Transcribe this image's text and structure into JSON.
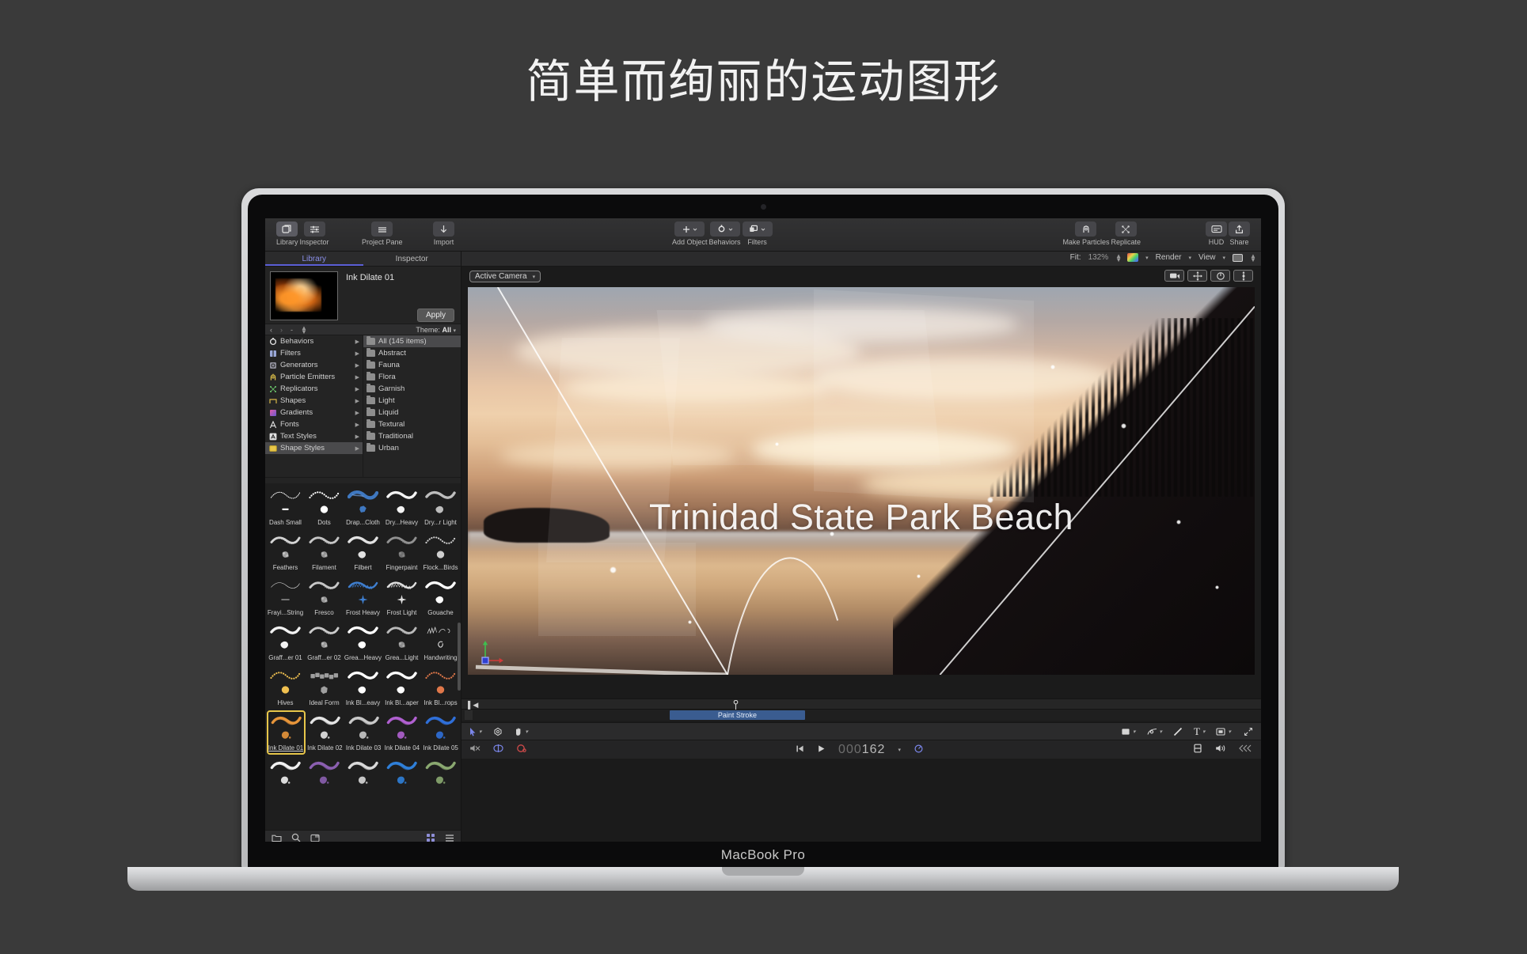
{
  "headline": "简单而绚丽的运动图形",
  "device": {
    "name": "MacBook Pro"
  },
  "toolbar": {
    "left_buttons": [
      {
        "label": "Library",
        "icon": "library-icon",
        "selected": true
      },
      {
        "label": "Inspector",
        "icon": "inspector-sliders-icon",
        "selected": false
      }
    ],
    "project_pane": {
      "label": "Project Pane",
      "icon": "list-lines-icon"
    },
    "import": {
      "label": "Import",
      "icon": "download-arrow-icon"
    },
    "center_buttons": [
      {
        "label": "Add Object",
        "icon": "plus-icon"
      },
      {
        "label": "Behaviors",
        "icon": "gear-circle-icon"
      },
      {
        "label": "Filters",
        "icon": "stacked-squares-icon"
      }
    ],
    "right_buttons": [
      {
        "label": "Make Particles",
        "icon": "particles-icon"
      },
      {
        "label": "Replicate",
        "icon": "replicate-icon"
      },
      {
        "label": "HUD",
        "icon": "hud-panel-icon"
      },
      {
        "label": "Share",
        "icon": "share-upload-icon"
      }
    ]
  },
  "infostrip": {
    "fit_label": "Fit:",
    "fit_value": "132%",
    "color_swatch_icon": "color-gradient-icon",
    "render_label": "Render",
    "view_label": "View",
    "display_icon": "display-rect-icon"
  },
  "left_panel": {
    "tabs": [
      {
        "label": "Library",
        "active": true
      },
      {
        "label": "Inspector",
        "active": false
      }
    ],
    "preview": {
      "name": "Ink Dilate 01",
      "apply_label": "Apply",
      "thumbnail_icon": "ink-dilate-thumbnail"
    },
    "libnav": {
      "back_icon": "chevron-left-icon",
      "forward_icon": "chevron-right-icon",
      "path": "-",
      "sort_icon": "sort-updown-icon",
      "theme_label": "Theme:",
      "theme_value": "All"
    },
    "categories": [
      {
        "label": "Behaviors",
        "icon": "behaviors-icon",
        "selected": false
      },
      {
        "label": "Filters",
        "icon": "filters-icon",
        "selected": false
      },
      {
        "label": "Generators",
        "icon": "generators-icon",
        "selected": false
      },
      {
        "label": "Particle Emitters",
        "icon": "particle-emitters-icon",
        "selected": false
      },
      {
        "label": "Replicators",
        "icon": "replicators-icon",
        "selected": false
      },
      {
        "label": "Shapes",
        "icon": "shapes-icon",
        "selected": false
      },
      {
        "label": "Gradients",
        "icon": "gradients-icon",
        "selected": false
      },
      {
        "label": "Fonts",
        "icon": "fonts-icon",
        "selected": false
      },
      {
        "label": "Text Styles",
        "icon": "text-styles-icon",
        "selected": false
      },
      {
        "label": "Shape Styles",
        "icon": "shape-styles-icon",
        "selected": true
      }
    ],
    "themes": [
      {
        "label": "All (145 items)",
        "selected": true
      },
      {
        "label": "Abstract",
        "selected": false
      },
      {
        "label": "Fauna",
        "selected": false
      },
      {
        "label": "Flora",
        "selected": false
      },
      {
        "label": "Garnish",
        "selected": false
      },
      {
        "label": "Light",
        "selected": false
      },
      {
        "label": "Liquid",
        "selected": false
      },
      {
        "label": "Textural",
        "selected": false
      },
      {
        "label": "Traditional",
        "selected": false
      },
      {
        "label": "Urban",
        "selected": false
      }
    ],
    "brushes": [
      {
        "label": "Dash Small",
        "color": "#ffffff",
        "style": "dash",
        "selected": false
      },
      {
        "label": "Dots",
        "color": "#ffffff",
        "style": "dots",
        "selected": false
      },
      {
        "label": "Drap...Cloth",
        "color": "#3f78c0",
        "style": "cloth",
        "selected": false
      },
      {
        "label": "Dry...Heavy",
        "color": "#f4f4f4",
        "style": "solid",
        "selected": false
      },
      {
        "label": "Dry...r Light",
        "color": "#bdbdbd",
        "style": "solid",
        "selected": false
      },
      {
        "label": "Feathers",
        "color": "#e6e6e6",
        "style": "rough",
        "selected": false
      },
      {
        "label": "Filament",
        "color": "#d6d6d6",
        "style": "rough",
        "selected": false
      },
      {
        "label": "Filbert",
        "color": "#e2e2e2",
        "style": "solid",
        "selected": false
      },
      {
        "label": "Fingerpaint",
        "color": "#9c9c9c",
        "style": "rough",
        "selected": false
      },
      {
        "label": "Flock...Birds",
        "color": "#cfcfcf",
        "style": "dots",
        "selected": false
      },
      {
        "label": "Frayi...String",
        "color": "#e8e8e8",
        "style": "thin",
        "selected": false
      },
      {
        "label": "Fresco",
        "color": "#d8d8d8",
        "style": "rough",
        "selected": false
      },
      {
        "label": "Frost Heavy",
        "color": "#3f7fd0",
        "style": "spiky",
        "selected": false
      },
      {
        "label": "Frost Light",
        "color": "#e0e0e0",
        "style": "spiky",
        "selected": false
      },
      {
        "label": "Gouache",
        "color": "#ffffff",
        "style": "solid",
        "selected": false
      },
      {
        "label": "Graff...er 01",
        "color": "#f2f2f2",
        "style": "solid",
        "selected": false
      },
      {
        "label": "Graff...er 02",
        "color": "#dcdcdc",
        "style": "rough",
        "selected": false
      },
      {
        "label": "Grea...Heavy",
        "color": "#ffffff",
        "style": "solid",
        "selected": false
      },
      {
        "label": "Grea...Light",
        "color": "#c9c9c9",
        "style": "rough",
        "selected": false
      },
      {
        "label": "Handwriting",
        "color": "#e9e9e9",
        "style": "script",
        "selected": false
      },
      {
        "label": "Hives",
        "color": "#f0c050",
        "style": "dots",
        "selected": false
      },
      {
        "label": "Ideal Form",
        "color": "#b6b6b6",
        "style": "blocks",
        "selected": false
      },
      {
        "label": "Ink Bl...eavy",
        "color": "#ffffff",
        "style": "solid",
        "selected": false
      },
      {
        "label": "Ink Bl...aper",
        "color": "#ffffff",
        "style": "solid",
        "selected": false
      },
      {
        "label": "Ink Bl...rops",
        "color": "#e0784a",
        "style": "dots",
        "selected": false
      },
      {
        "label": "Ink Dilate 01",
        "color": "#e7953a",
        "style": "ink",
        "selected": true
      },
      {
        "label": "Ink Dilate 02",
        "color": "#e4e4e4",
        "style": "ink",
        "selected": false
      },
      {
        "label": "Ink Dilate 03",
        "color": "#c8c8c8",
        "style": "ink",
        "selected": false
      },
      {
        "label": "Ink Dilate 04",
        "color": "#b060d0",
        "style": "ink",
        "selected": false
      },
      {
        "label": "Ink Dilate 05",
        "color": "#2f6fd8",
        "style": "ink",
        "selected": false
      },
      {
        "label": "",
        "color": "#f0f0f0",
        "style": "ink",
        "selected": false
      },
      {
        "label": "",
        "color": "#8b5fb0",
        "style": "ink",
        "selected": false
      },
      {
        "label": "",
        "color": "#d8d8d8",
        "style": "ink",
        "selected": false
      },
      {
        "label": "",
        "color": "#2f7fd8",
        "style": "ink",
        "selected": false
      },
      {
        "label": "",
        "color": "#8aa870",
        "style": "ink",
        "selected": false
      }
    ],
    "footer_icons": [
      "new-folder-icon",
      "search-icon",
      "new-window-icon",
      "grid-view-icon",
      "list-view-icon"
    ]
  },
  "canvas": {
    "camera_selector": "Active Camera",
    "view_buttons": [
      "camera-view-icon",
      "pan-axes-icon",
      "orbit-icon",
      "dolly-icon"
    ],
    "overlay_title": "Trinidad State Park Beach",
    "axis_widget_icon": "3d-axis-widget"
  },
  "timeline": {
    "clip_label": "Paint Stroke",
    "start_marker_icon": "start-marker-icon",
    "playhead_icon": "playhead-icon"
  },
  "tools": {
    "select_icon": "arrow-select-icon",
    "transform_icon": "transform-icon",
    "pan_icon": "hand-pan-icon",
    "shape_icon": "rect-shape-icon",
    "bezier_icon": "bezier-pen-icon",
    "line_icon": "line-icon",
    "text_icon": "text-tool-icon",
    "mask_icon": "mask-icon",
    "fullscreen_icon": "expand-arrows-icon",
    "text_label": "T"
  },
  "transport": {
    "mute_icon": "mute-icon",
    "loop_icon": "loop-icon",
    "record_icon": "record-keyframe-icon",
    "goto_start_icon": "go-to-start-icon",
    "play_icon": "play-icon",
    "timecode": "000162",
    "timecode_dim_prefix": "000",
    "timecode_value": "162",
    "keyframe_icon": "keyframe-icon",
    "render_quality_icon": "render-quality-icon",
    "audio_icon": "audio-icon",
    "background_icon": "background-layers-icon"
  },
  "colors": {
    "accent_blue": "#5b5fd6",
    "selection_yellow": "#e7c64a",
    "clip_blue": "#3a5c90",
    "panel_bg": "#242424",
    "toolbar_bg": "#2e2e2f"
  }
}
